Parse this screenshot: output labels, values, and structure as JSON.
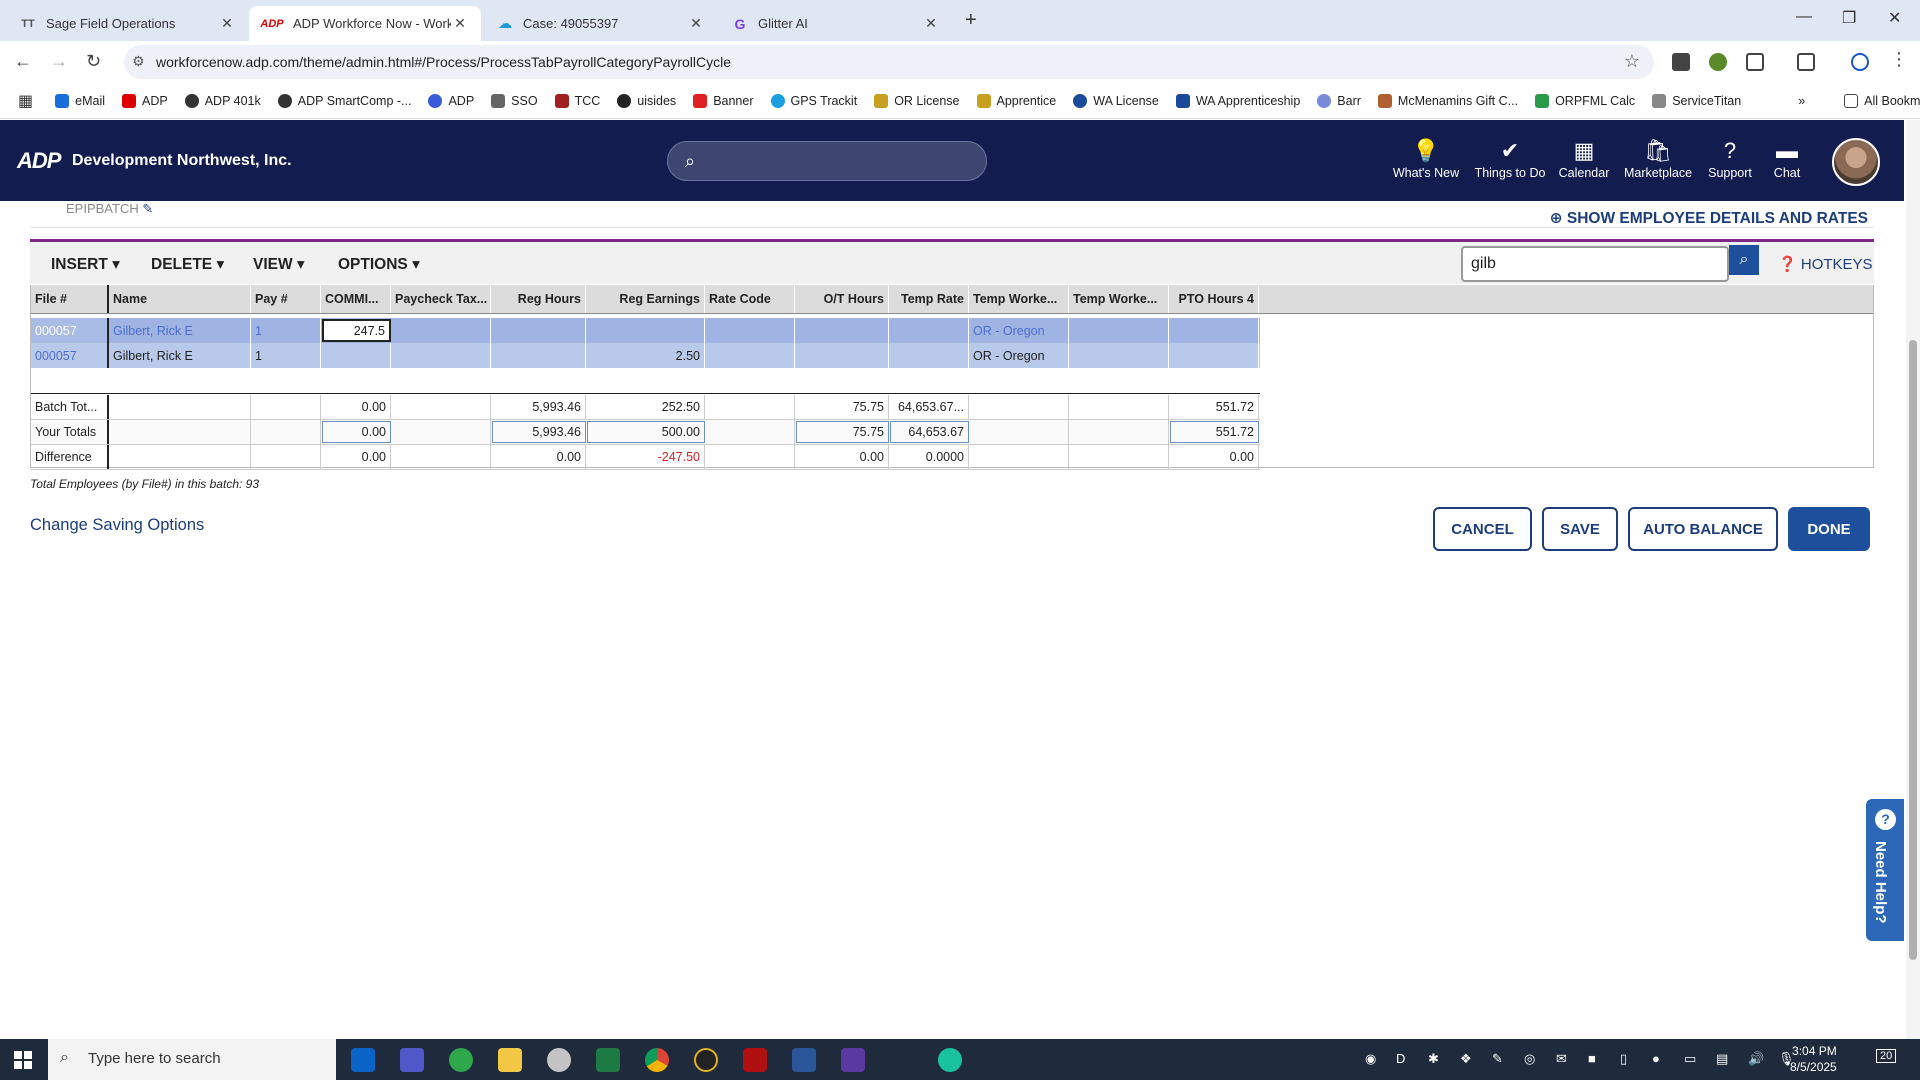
{
  "browser": {
    "tabs": [
      {
        "title": "Sage Field Operations",
        "favicon": "TT"
      },
      {
        "title": "ADP Workforce Now - Worksheet",
        "favicon": "ADP",
        "active": true
      },
      {
        "title": "Case: 49055397",
        "favicon": "salesforce-cloud"
      },
      {
        "title": "Glitter AI",
        "favicon": "G"
      }
    ],
    "url": "workforcenow.adp.com/theme/admin.html#/Process/ProcessTabPayrollCategoryPayrollCycle",
    "bookmarks": [
      "eMail",
      "ADP",
      "ADP 401k",
      "ADP SmartComp -...",
      "ADP",
      "SSO",
      "TCC",
      "uisides",
      "Banner",
      "GPS Trackit",
      "OR License",
      "Apprentice",
      "WA License",
      "WA Apprenticeship",
      "Barr",
      "McMenamins Gift C...",
      "ORPFML Calc",
      "ServiceTitan"
    ],
    "bookmark_more": "»",
    "all_bookmarks": "All Bookmarks"
  },
  "adp": {
    "logo": "ADP",
    "company": "Development Northwest, Inc.",
    "nav": [
      {
        "label": "What's New",
        "icon": "lightbulb-icon"
      },
      {
        "label": "Things to Do",
        "icon": "checkmark-icon"
      },
      {
        "label": "Calendar",
        "icon": "calendar-icon"
      },
      {
        "label": "Marketplace",
        "icon": "shopping-bag-icon"
      },
      {
        "label": "Support",
        "icon": "help-icon"
      },
      {
        "label": "Chat",
        "icon": "chat-icon"
      }
    ]
  },
  "page": {
    "batch_name": "EPIPBATCH",
    "show_details": "SHOW EMPLOYEE DETAILS AND RATES",
    "toolbar": {
      "insert": "INSERT",
      "delete": "DELETE",
      "view": "VIEW",
      "options": "OPTIONS"
    },
    "search_value": "gilb",
    "hotkeys": "HOTKEYS",
    "columns": [
      "File #",
      "Name",
      "Pay #",
      "COMMI...",
      "Paycheck Tax...",
      "Reg Hours",
      "Reg Earnings",
      "Rate Code",
      "O/T Hours",
      "Temp Rate",
      "Temp Worke...",
      "Temp Worke...",
      "PTO Hours 4"
    ],
    "rows": [
      {
        "file": "000057",
        "name": "Gilbert, Rick E",
        "pay": "1",
        "commi": "247.5",
        "paycheck": "",
        "reg_hours": "",
        "reg_earnings": "",
        "rate_code": "",
        "ot_hours": "",
        "temp_rate": "",
        "temp_work1": "OR - Oregon",
        "temp_work2": "",
        "pto4": ""
      },
      {
        "file": "000057",
        "name": "Gilbert, Rick E",
        "pay": "1",
        "commi": "",
        "paycheck": "",
        "reg_hours": "",
        "reg_earnings": "2.50",
        "rate_code": "",
        "ot_hours": "",
        "temp_rate": "",
        "temp_work1": "OR - Oregon",
        "temp_work2": "",
        "pto4": ""
      }
    ],
    "totals": [
      {
        "label": "Batch Tot...",
        "commi": "0.00",
        "reg_hours": "5,993.46",
        "reg_earnings": "252.50",
        "ot_hours": "75.75",
        "temp_rate": "64,653.67...",
        "pto4": "551.72"
      },
      {
        "label": "Your Totals",
        "commi": "0.00",
        "reg_hours": "5,993.46",
        "reg_earnings": "500.00",
        "ot_hours": "75.75",
        "temp_rate": "64,653.67",
        "pto4": "551.72"
      },
      {
        "label": "Difference",
        "commi": "0.00",
        "reg_hours": "0.00",
        "reg_earnings": "-247.50",
        "ot_hours": "0.00",
        "temp_rate": "0.0000",
        "pto4": "0.00"
      }
    ],
    "total_employees": "Total Employees (by File#) in this batch: 93",
    "change_saving": "Change Saving Options",
    "buttons": {
      "cancel": "CANCEL",
      "save": "SAVE",
      "auto_balance": "AUTO BALANCE",
      "done": "DONE"
    },
    "need_help": "Need Help?"
  },
  "taskbar": {
    "search_placeholder": "Type here to search",
    "time": "3:04 PM",
    "date": "8/5/2025",
    "notifications": "20"
  },
  "colors": {
    "adp_navy": "#121c4e",
    "accent_blue": "#1d4f9c",
    "purple_rule": "#7a2a84",
    "row_highlight": "#b9c9e9",
    "negative": "#d42020"
  }
}
